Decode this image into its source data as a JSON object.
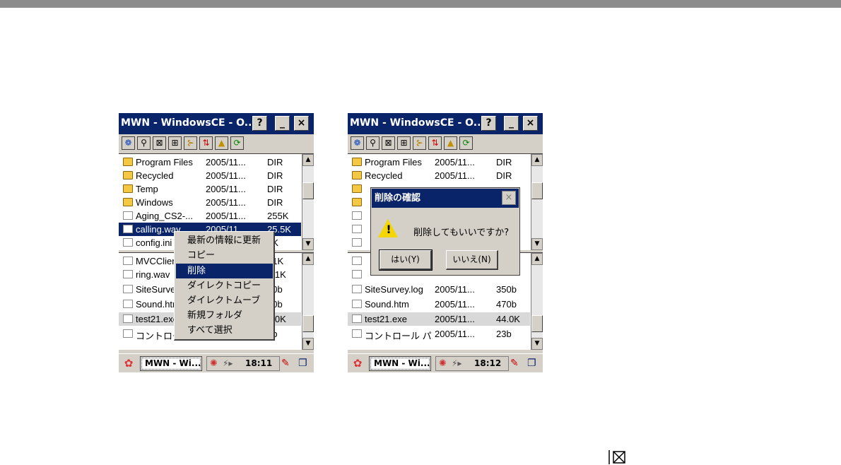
{
  "screens": [
    {
      "title": "MWN - WindowsCE - O...",
      "title_buttons": {
        "help": "?",
        "minimize": "_",
        "close": "×"
      },
      "toolbar_icons": [
        "globe-icon",
        "key-icon",
        "delete-icon",
        "split-icon",
        "tree-icon",
        "sort-icon",
        "folder-up-icon",
        "refresh-icon"
      ],
      "pane1": [
        {
          "type": "folder",
          "name": "Program Files",
          "date": "2005/11...",
          "size": "DIR"
        },
        {
          "type": "folder",
          "name": "Recycled",
          "date": "2005/11...",
          "size": "DIR"
        },
        {
          "type": "folder",
          "name": "Temp",
          "date": "2005/11...",
          "size": "DIR"
        },
        {
          "type": "folder",
          "name": "Windows",
          "date": "2005/11...",
          "size": "DIR"
        },
        {
          "type": "file",
          "name": "Aging_CS2-...",
          "date": "2005/11...",
          "size": "255K"
        },
        {
          "type": "file",
          "name": "calling.wav",
          "date": "2005/11...",
          "size": "25.5K",
          "selected": true
        },
        {
          "type": "file",
          "name": "config.ini",
          "date": "",
          "size": "1K"
        }
      ],
      "pane2": [
        {
          "type": "file",
          "name": "MVCClient",
          "date": "",
          "size": "41K"
        },
        {
          "type": "file",
          "name": "ring.wav",
          "date": "",
          "size": "7.1K"
        },
        {
          "type": "file",
          "name": "SiteSurvey",
          "date": "",
          "size": "50b"
        },
        {
          "type": "file",
          "name": "Sound.htm",
          "date": "",
          "size": "70b"
        },
        {
          "type": "file",
          "name": "test21.exe",
          "date": "",
          "size": "4.0K",
          "highlight": true
        },
        {
          "type": "file",
          "name": "コントロール",
          "date": "",
          "size": "3b"
        }
      ],
      "context_menu": [
        "最新の情報に更新",
        "コピー",
        "削除",
        "ダイレクトコピー",
        "ダイレクトムーブ",
        "新規フォルダ",
        "すべて選択"
      ],
      "context_active": 2,
      "taskbar": {
        "task": "MWN - Wi...",
        "clock": "18:11"
      }
    },
    {
      "title": "MWN - WindowsCE - O...",
      "title_buttons": {
        "help": "?",
        "minimize": "_",
        "close": "×"
      },
      "pane1": [
        {
          "type": "folder",
          "name": "Program Files",
          "date": "2005/11...",
          "size": "DIR"
        },
        {
          "type": "folder",
          "name": "Recycled",
          "date": "2005/11...",
          "size": "DIR"
        }
      ],
      "pane2": [
        {
          "type": "file",
          "name": "SiteSurvey.log",
          "date": "2005/11...",
          "size": "350b"
        },
        {
          "type": "file",
          "name": "Sound.htm",
          "date": "2005/11...",
          "size": "470b"
        },
        {
          "type": "file",
          "name": "test21.exe",
          "date": "2005/11...",
          "size": "44.0K",
          "highlight": true
        },
        {
          "type": "file",
          "name": "コントロール パ...",
          "date": "2005/11...",
          "size": "23b"
        }
      ],
      "dialog": {
        "title": "削除の確認",
        "message": "削除してもいいですか?",
        "yes": "はい(Y)",
        "no": "いいえ(N)",
        "close": "×"
      },
      "taskbar": {
        "task": "MWN - Wi...",
        "clock": "18:12"
      }
    }
  ],
  "footer_icon": "delete-icon"
}
